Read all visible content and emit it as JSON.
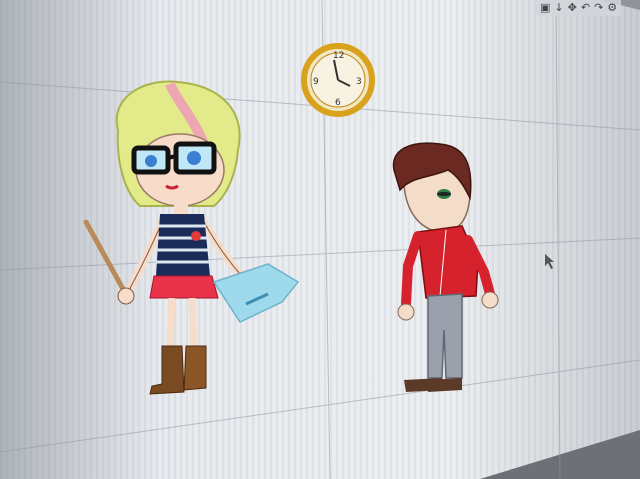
{
  "scene": {
    "toolbar_icons": [
      "window-icon",
      "down-arrow-icon",
      "move-icon",
      "undo-icon",
      "redo-icon",
      "settings-icon"
    ],
    "toolbar_glyphs": [
      "▣",
      "↓",
      "✥",
      "↶",
      "↷",
      "⚙"
    ],
    "clock": {
      "digits": [
        "12",
        "3",
        "6",
        "9"
      ]
    },
    "colors": {
      "screen": "#e9ecef",
      "clock_rim": "#d9a21c",
      "girl_hair": "#e2ea8a",
      "girl_hair_streak": "#f09ab8",
      "girl_skirt": "#e8334a",
      "girl_boots": "#7a4a22",
      "paper": "#9fd9ec",
      "boy_hair": "#6a2a22",
      "boy_jacket": "#d6222c",
      "boy_pants": "#9aa1ad"
    }
  }
}
